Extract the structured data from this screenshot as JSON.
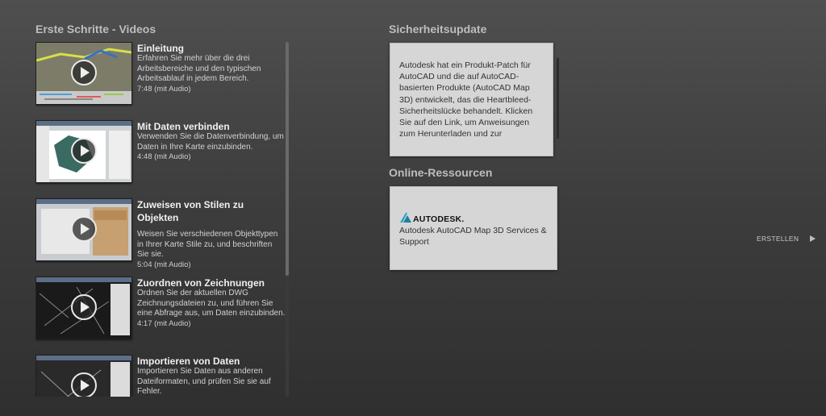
{
  "videos": {
    "title": "Erste Schritte - Videos",
    "items": [
      {
        "title": "Einleitung",
        "desc": "Erfahren Sie mehr über die drei Arbeitsbereiche und den typischen Arbeitsablauf in jedem Bereich.",
        "duration": "7:48 (mit Audio)"
      },
      {
        "title": "Mit Daten verbinden",
        "desc": "Verwenden Sie die Datenverbindung, um Daten in Ihre Karte einzubinden.",
        "duration": "4:48 (mit Audio)"
      },
      {
        "title": "Zuweisen von Stilen zu Objekten",
        "desc": "Weisen Sie verschiedenen Objekttypen in Ihrer Karte Stile zu, und beschriften Sie sie.",
        "duration": "5:04 (mit Audio)"
      },
      {
        "title": "Zuordnen von Zeichnungen",
        "desc": "Ordnen Sie der aktuellen DWG Zeichnungsdateien zu, und führen Sie eine Abfrage aus, um Daten einzubinden.",
        "duration": "4:17 (mit Audio)"
      },
      {
        "title": "Importieren von Daten",
        "desc": "Importieren Sie Daten aus anderen Dateiformaten, und prüfen Sie sie auf Fehler.",
        "duration": ""
      }
    ]
  },
  "security": {
    "title": "Sicherheitsupdate",
    "text": "Autodesk hat ein Produkt-Patch für AutoCAD und die auf AutoCAD-basierten Produkte (AutoCAD Map 3D) entwickelt, das die Heartbleed-Sicherheitslücke behandelt. Klicken Sie auf den Link, um Anweisungen zum Herunterladen und zur"
  },
  "online": {
    "title": "Online-Ressourcen",
    "logo_text": "AUTODESK.",
    "link": "Autodesk AutoCAD Map 3D Services & Support"
  },
  "create": {
    "label": "ERSTELLEN"
  },
  "icons": {
    "play": "play-icon",
    "logo": "autodesk-logo-icon",
    "arrow": "triangle-right-icon"
  }
}
